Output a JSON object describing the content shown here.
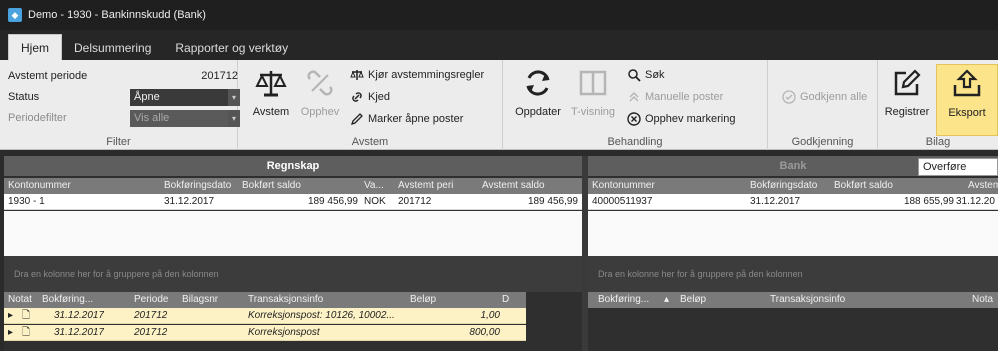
{
  "window": {
    "title": "Demo - 1930 - Bankinnskudd (Bank)"
  },
  "tabs": [
    {
      "label": "Hjem"
    },
    {
      "label": "Delsummering"
    },
    {
      "label": "Rapporter og verktøy"
    }
  ],
  "filter": {
    "group_label": "Filter",
    "avstemt_periode_label": "Avstemt periode",
    "avstemt_periode_value": "201712",
    "status_label": "Status",
    "status_value": "Åpne",
    "periodefilter_label": "Periodefilter",
    "periodefilter_value": "Vis alle"
  },
  "avstem_group": {
    "group_label": "Avstem",
    "avstem_label": "Avstem",
    "opphev_label": "Opphev",
    "kjor_label": "Kjør avstemmingsregler",
    "kjed_label": "Kjed",
    "marker_label": "Marker åpne poster"
  },
  "behandling_group": {
    "group_label": "Behandling",
    "oppdater_label": "Oppdater",
    "tvisning_label": "T-visning",
    "sok_label": "Søk",
    "manuelle_label": "Manuelle poster",
    "opphev_markering_label": "Opphev markering"
  },
  "godkjenning_group": {
    "group_label": "Godkjenning",
    "godkjenn_label": "Godkjenn alle"
  },
  "bilag_group": {
    "group_label": "Bilag",
    "registrer_label": "Registrer",
    "eksport_label": "Eksport"
  },
  "regnskap": {
    "title": "Regnskap",
    "columns": [
      "Kontonummer",
      "Bokføringsdato",
      "Bokført saldo",
      "Va...",
      "Avstemt peri",
      "Avstemt saldo"
    ],
    "row": [
      "1930 - 1",
      "31.12.2017",
      "189 456,99",
      "NOK",
      "201712",
      "189 456,99"
    ],
    "group_hint": "Dra en kolonne her for å gruppere på den kolonnen",
    "tx_columns": [
      "Notat",
      "Bokføring...",
      "Periode",
      "Bilagsnr",
      "Transaksjonsinfo",
      "Beløp",
      "D"
    ],
    "tx_rows": [
      {
        "date": "31.12.2017",
        "period": "201712",
        "info": "Korreksjonspost: 10126, 10002...",
        "amount": "1,00"
      },
      {
        "date": "31.12.2017",
        "period": "201712",
        "info": "Korreksjonspost",
        "amount": "800,00"
      }
    ]
  },
  "bank": {
    "title": "Bank",
    "overfore_label": "Overføre",
    "columns": [
      "Kontonummer",
      "Bokføringsdato",
      "Bokført saldo",
      "Avstemt"
    ],
    "row": [
      "40000511937",
      "31.12.2017",
      "188 655,99",
      "31.12.20"
    ],
    "group_hint": "Dra en kolonne her for å gruppere på den kolonnen",
    "tx_columns": [
      "Bokføring...",
      "Beløp",
      "Transaksjonsinfo",
      "Nota"
    ]
  }
}
